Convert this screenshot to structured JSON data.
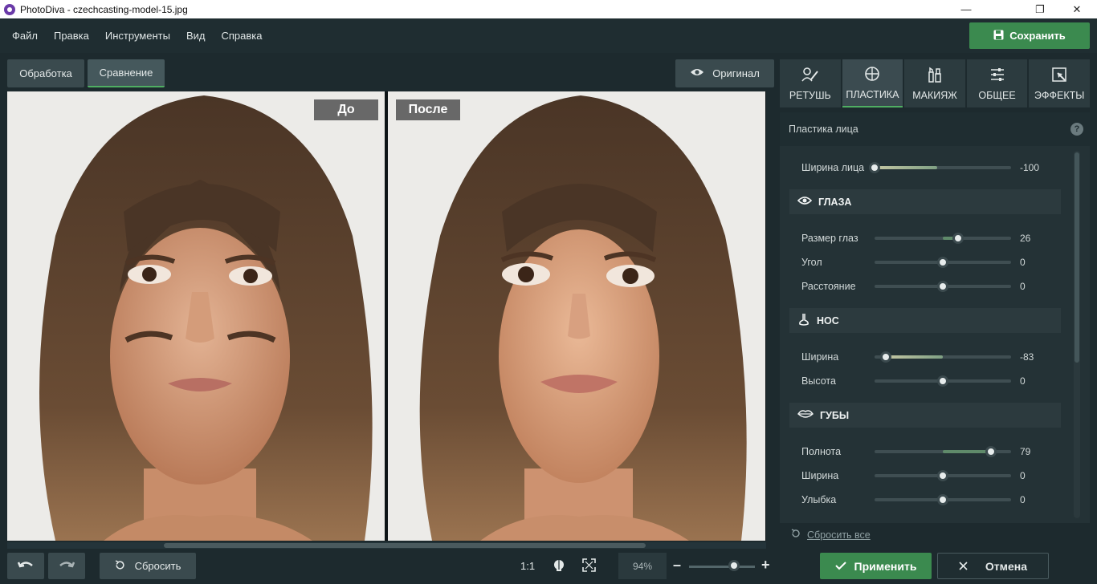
{
  "window": {
    "title": "PhotoDiva - czechcasting-model-15.jpg",
    "minimize_glyph": "—",
    "maximize_glyph": "❐",
    "close_glyph": "✕"
  },
  "menu": [
    "Файл",
    "Правка",
    "Инструменты",
    "Вид",
    "Справка"
  ],
  "save_button": {
    "label": "Сохранить",
    "icon": "floppy-disk-icon"
  },
  "view_tabs": {
    "processing": "Обработка",
    "comparison": "Сравнение",
    "active": "comparison"
  },
  "original_button": {
    "label": "Оригинал",
    "icon": "eye-icon"
  },
  "photos": {
    "before_label": "До",
    "after_label": "После"
  },
  "right_tabs": [
    {
      "label": "РЕТУШЬ",
      "icon": "retouch-icon"
    },
    {
      "label": "ПЛАСТИКА",
      "icon": "plastic-icon",
      "active": true
    },
    {
      "label": "МАКИЯЖ",
      "icon": "makeup-icon"
    },
    {
      "label": "ОБЩЕЕ",
      "icon": "sliders-icon"
    },
    {
      "label": "ЭФФЕКТЫ",
      "icon": "effects-icon"
    }
  ],
  "panel": {
    "title": "Пластика лица",
    "help": "?",
    "face_width": {
      "label": "Ширина лица",
      "value": "-100"
    },
    "eyes": {
      "title": "ГЛАЗА",
      "size": {
        "label": "Размер глаз",
        "value": "26"
      },
      "angle": {
        "label": "Угол",
        "value": "0"
      },
      "distance": {
        "label": "Расстояние",
        "value": "0"
      }
    },
    "nose": {
      "title": "НОС",
      "width": {
        "label": "Ширина",
        "value": "-83"
      },
      "height": {
        "label": "Высота",
        "value": "0"
      }
    },
    "lips": {
      "title": "ГУБЫ",
      "fullness": {
        "label": "Полнота",
        "value": "79"
      },
      "width": {
        "label": "Ширина",
        "value": "0"
      },
      "smile": {
        "label": "Улыбка",
        "value": "0"
      }
    },
    "reset_all": "Сбросить все"
  },
  "bottom": {
    "reset_label": "Сбросить",
    "ratio": "1:1",
    "zoom": "94%",
    "zoom_minus": "–",
    "zoom_plus": "+",
    "apply_label": "Применить",
    "cancel_label": "Отмена"
  },
  "colors": {
    "accent_green": "#3b8a4f",
    "panel_bg": "#243236",
    "background": "#1d2a2e"
  }
}
